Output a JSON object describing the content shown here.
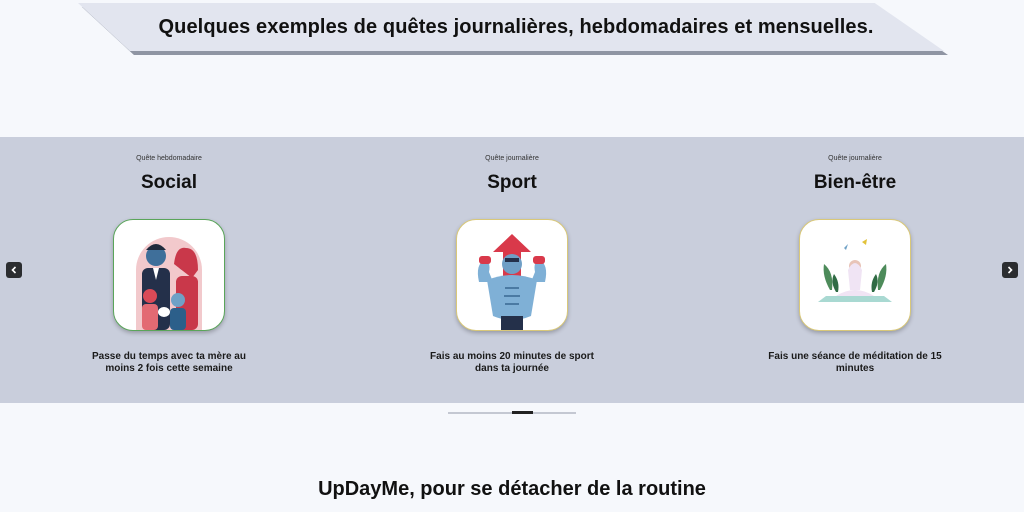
{
  "banner": {
    "title": "Quelques exemples de quêtes journalières, hebdomadaires et mensuelles."
  },
  "carousel": {
    "cards": [
      {
        "type": "Quête hebdomadaire",
        "title": "Social",
        "description": "Passe du temps avec ta mère au moins 2 fois cette semaine",
        "icon": "family-illustration-icon"
      },
      {
        "type": "Quête journalière",
        "title": "Sport",
        "description": "Fais au moins 20 minutes de sport dans ta journée",
        "icon": "muscle-man-illustration-icon"
      },
      {
        "type": "Quête journalière",
        "title": "Bien-être",
        "description": "Fais une séance de méditation de 15 minutes",
        "icon": "meditation-illustration-icon"
      }
    ],
    "prev_icon": "chevron-left-icon",
    "next_icon": "chevron-right-icon"
  },
  "footer": {
    "title": "UpDayMe, pour se détacher de la routine"
  },
  "colors": {
    "band": "#c9cedc",
    "background": "#f6f8fc",
    "banner": "#e2e5ef"
  }
}
